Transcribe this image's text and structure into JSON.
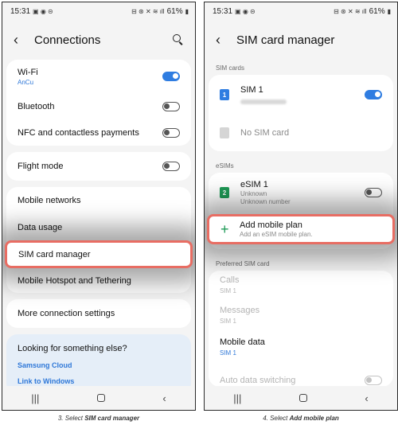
{
  "left": {
    "status": {
      "time": "15:31",
      "battery": "61%"
    },
    "header": {
      "title": "Connections"
    },
    "items": {
      "wifi": {
        "label": "Wi-Fi",
        "network": "AnCu",
        "on": true
      },
      "bluetooth": {
        "label": "Bluetooth",
        "on": false
      },
      "nfc": {
        "label": "NFC and contactless payments",
        "on": false
      },
      "flight": {
        "label": "Flight mode",
        "on": false
      },
      "mobile_networks": "Mobile networks",
      "data_usage": "Data usage",
      "sim_manager": "SIM card manager",
      "hotspot": "Mobile Hotspot and Tethering",
      "more": "More connection settings"
    },
    "suggest": {
      "title": "Looking for something else?",
      "links": [
        "Samsung Cloud",
        "Link to Windows"
      ]
    },
    "caption": {
      "prefix": "3. Select ",
      "bold": "SIM card manager"
    }
  },
  "right": {
    "status": {
      "time": "15:31",
      "battery": "61%"
    },
    "header": {
      "title": "SIM card manager"
    },
    "sim_section": "SIM cards",
    "sim1": {
      "name": "SIM 1",
      "badge": "1",
      "on": true
    },
    "no_sim": "No SIM card",
    "esim_section": "eSIMs",
    "esim1": {
      "name": "eSIM 1",
      "line1": "Unknown",
      "line2": "Unknown number",
      "badge": "2",
      "on": false
    },
    "add_plan": {
      "title": "Add mobile plan",
      "sub": "Add an eSIM mobile plan."
    },
    "pref_section": "Preferred SIM card",
    "calls": {
      "title": "Calls",
      "value": "SIM 1"
    },
    "messages": {
      "title": "Messages",
      "value": "SIM 1"
    },
    "mobile_data": {
      "title": "Mobile data",
      "value": "SIM 1"
    },
    "auto_switch": {
      "title": "Auto data switching"
    },
    "caption": {
      "prefix": "4. Select ",
      "bold": "Add mobile plan"
    }
  },
  "icons": [
    "back-arrow-icon",
    "search-icon",
    "recents-icon",
    "home-icon",
    "back-icon",
    "plus-icon",
    "sim-icon"
  ],
  "colors": {
    "accent": "#2f7de1",
    "highlight": "#e86d63",
    "esim_green": "#1e9a56"
  }
}
